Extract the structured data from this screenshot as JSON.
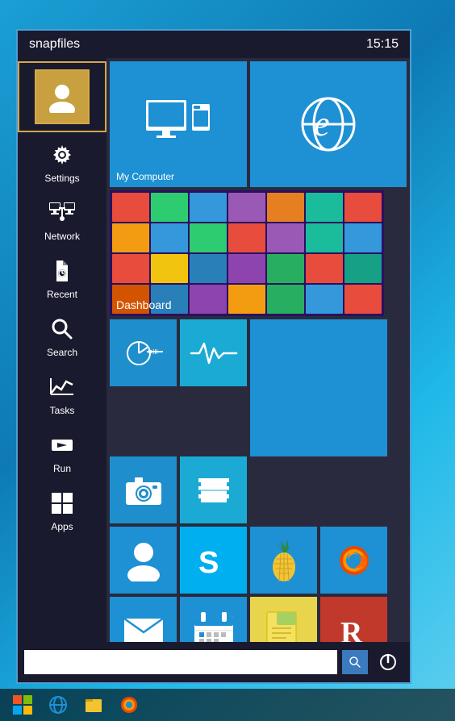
{
  "header": {
    "title": "snapfiles",
    "time": "15:15"
  },
  "sidebar": {
    "items": [
      {
        "id": "user",
        "label": "",
        "icon": "user-icon",
        "active": true
      },
      {
        "id": "settings",
        "label": "Settings",
        "icon": "settings-icon"
      },
      {
        "id": "network",
        "label": "Network",
        "icon": "network-icon"
      },
      {
        "id": "recent",
        "label": "Recent",
        "icon": "recent-icon"
      },
      {
        "id": "search",
        "label": "Search",
        "icon": "search-icon"
      },
      {
        "id": "tasks",
        "label": "Tasks",
        "icon": "tasks-icon"
      },
      {
        "id": "run",
        "label": "Run",
        "icon": "run-icon"
      },
      {
        "id": "apps",
        "label": "Apps",
        "icon": "apps-icon"
      }
    ]
  },
  "tiles": {
    "row1": [
      {
        "id": "my-computer",
        "label": "My Computer",
        "color": "#1e90d4"
      },
      {
        "id": "internet-explorer",
        "label": "",
        "color": "#1e90d4"
      }
    ],
    "row2": [
      {
        "id": "dashboard",
        "label": "Dashboard",
        "color": "#4a3a8a"
      }
    ]
  },
  "bottom_bar": {
    "search_placeholder": "",
    "search_btn_label": "🔍",
    "power_btn_label": "⏻"
  },
  "taskbar": {
    "items": [
      {
        "id": "start",
        "label": "⊞",
        "color": "#ff0000"
      },
      {
        "id": "ie",
        "label": "e"
      },
      {
        "id": "explorer",
        "label": "📁"
      },
      {
        "id": "firefox",
        "label": "🦊"
      }
    ]
  }
}
